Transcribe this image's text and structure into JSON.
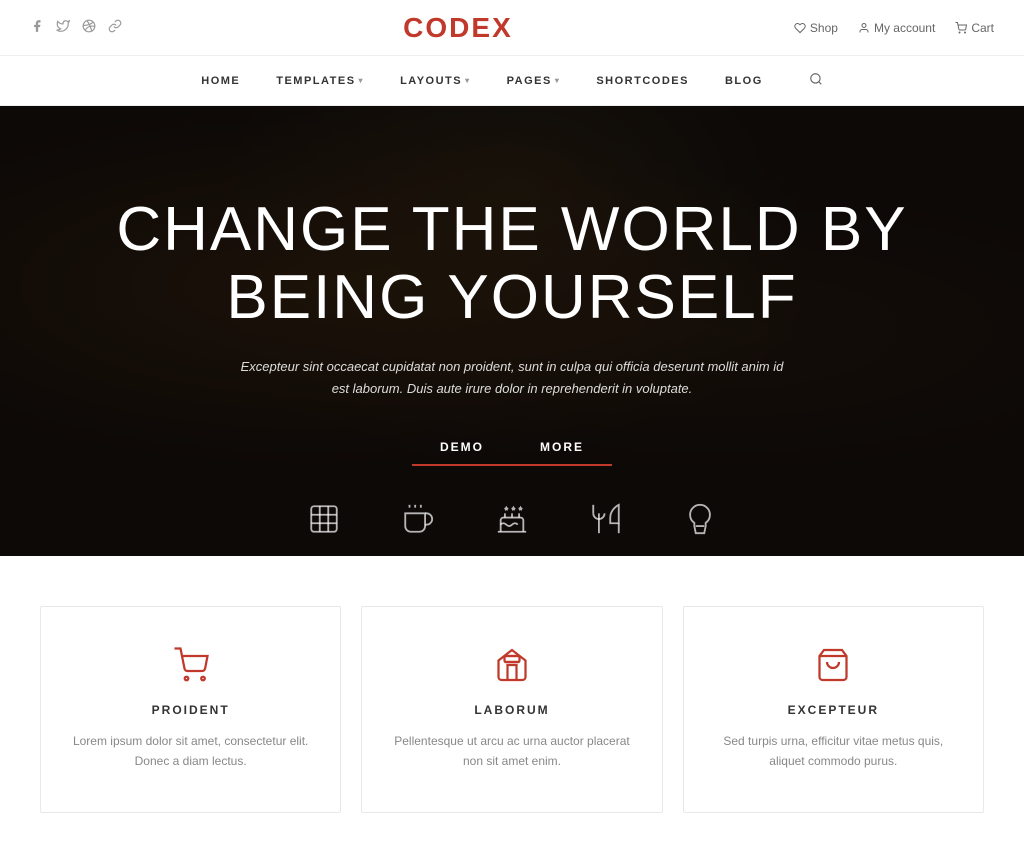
{
  "topBar": {
    "social": {
      "facebook": "f",
      "twitter": "t",
      "gplus": "g+",
      "link": "🔗"
    },
    "logo": "CODEX",
    "right": {
      "shop": "Shop",
      "myAccount": "My account",
      "cart": "Cart"
    }
  },
  "nav": {
    "items": [
      {
        "label": "HOME",
        "hasDropdown": false
      },
      {
        "label": "TEMPLATES",
        "hasDropdown": true
      },
      {
        "label": "LAYOUTS",
        "hasDropdown": true
      },
      {
        "label": "PAGES",
        "hasDropdown": true
      },
      {
        "label": "SHORTCODES",
        "hasDropdown": false
      },
      {
        "label": "BLOG",
        "hasDropdown": false
      }
    ]
  },
  "hero": {
    "title_line1": "CHANGE THE WORLD BY",
    "title_line2": "BEING YOURSELF",
    "subtitle": "Excepteur sint occaecat cupidatat non proident, sunt in culpa qui officia deserunt mollit anim id est laborum. Duis aute irure dolor in reprehenderit in voluptate.",
    "btn_demo": "DEMO",
    "btn_more": "MORE"
  },
  "features": [
    {
      "id": "proident",
      "icon": "cart",
      "title": "PROIDENT",
      "text": "Lorem ipsum dolor sit amet, consectetur elit. Donec a diam lectus."
    },
    {
      "id": "laborum",
      "icon": "store",
      "title": "LABORUM",
      "text": "Pellentesque ut arcu ac urna auctor placerat non sit amet enim."
    },
    {
      "id": "excepteur",
      "icon": "bag",
      "title": "EXCEPTEUR",
      "text": "Sed turpis urna, efficitur vitae metus quis, aliquet commodo purus."
    }
  ],
  "colors": {
    "accent": "#c0392b",
    "text": "#333",
    "light": "#888"
  }
}
